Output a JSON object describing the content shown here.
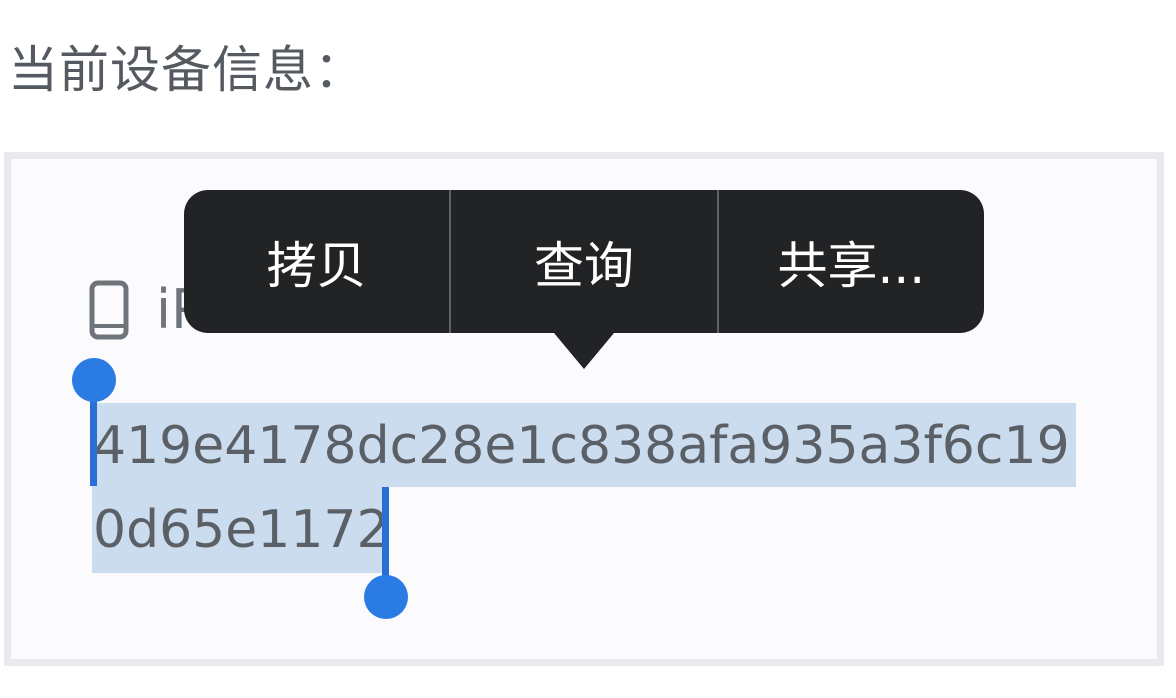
{
  "section": {
    "title": "当前设备信息："
  },
  "device": {
    "icon": "smartphone-icon",
    "name": "iPhone"
  },
  "token": {
    "text": "419e4178dc28e1c838afa935a3f6c190d65e1172",
    "selection_color": "#cbdcee",
    "handle_color": "#2a7be4"
  },
  "context_menu": {
    "background": "#222325",
    "items": [
      {
        "label": "拷贝"
      },
      {
        "label": "查询"
      },
      {
        "label": "共享..."
      }
    ]
  }
}
